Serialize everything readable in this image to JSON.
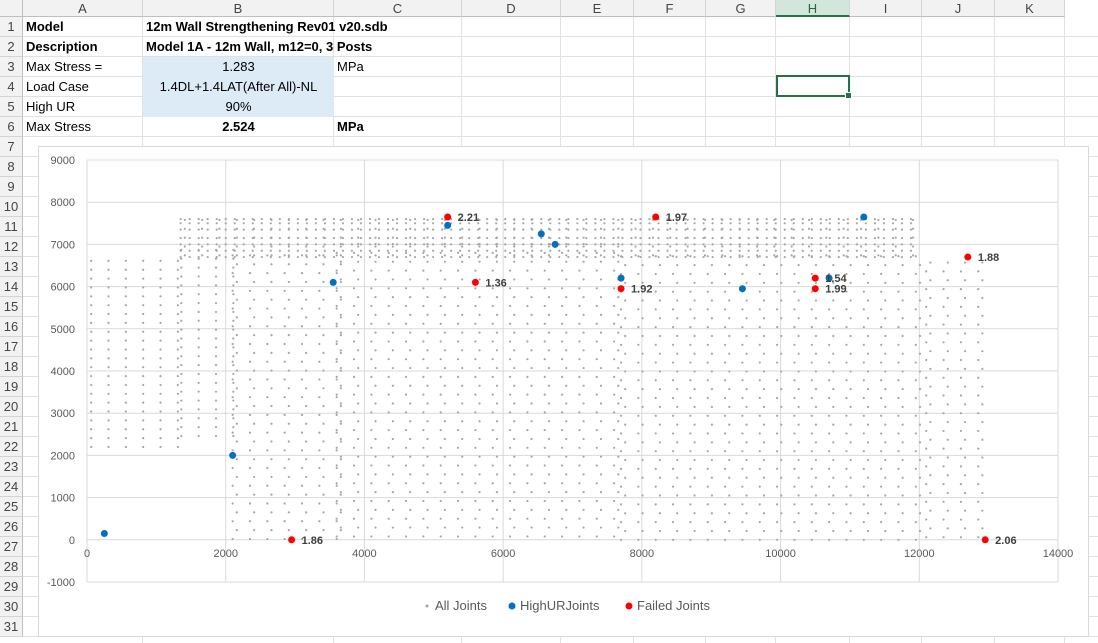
{
  "columns": [
    "A",
    "B",
    "C",
    "D",
    "E",
    "F",
    "G",
    "H",
    "I",
    "J",
    "K"
  ],
  "selected_column": "H",
  "rows": [
    "1",
    "2",
    "3",
    "4",
    "5",
    "6",
    "7",
    "8",
    "9",
    "10",
    "11",
    "12",
    "13",
    "14",
    "15",
    "16",
    "17",
    "18",
    "19",
    "20",
    "21",
    "22",
    "23",
    "24",
    "25",
    "26",
    "27",
    "28",
    "29",
    "30",
    "31"
  ],
  "cells": {
    "A1": "Model",
    "B1": "12m Wall Strengthening Rev01 v20.sdb",
    "A2": "Description",
    "B2": "Model 1A - 12m Wall, m12=0, 3 Posts",
    "A3": "Max Stress =",
    "B3": "1.283",
    "C3": "MPa",
    "A4": "Load Case",
    "B4": "1.4DL+1.4LAT(After All)-NL",
    "A5": "High UR",
    "B5": "90%",
    "A6": "Max Stress",
    "B6": "2.524",
    "C6": "MPa"
  },
  "chart_data": {
    "type": "scatter",
    "title": "",
    "xlabel": "",
    "ylabel": "",
    "xlim": [
      0,
      14000
    ],
    "ylim": [
      -1000,
      9000
    ],
    "x_ticks": [
      "0",
      "2000",
      "4000",
      "6000",
      "8000",
      "10000",
      "12000",
      "14000"
    ],
    "y_ticks": [
      "-1000",
      "0",
      "1000",
      "2000",
      "3000",
      "4000",
      "5000",
      "6000",
      "7000",
      "8000",
      "9000"
    ],
    "grid": true,
    "legend": "bottom",
    "series": [
      {
        "name": "All Joints",
        "color": "#a6a6a6",
        "marker": "small-dot",
        "note_points": "dense grid of joints approx x 0-13000, y 0-7600",
        "regions": [
          {
            "x": [
              0,
              1300
            ],
            "y": [
              2200,
              6700
            ]
          },
          {
            "x": [
              1300,
              2100
            ],
            "y": [
              2400,
              7000
            ]
          },
          {
            "x": [
              2100,
              3600
            ],
            "y": [
              0,
              6800
            ]
          },
          {
            "x": [
              3600,
              7700
            ],
            "y": [
              0,
              7100
            ]
          },
          {
            "x": [
              1350,
              12000
            ],
            "y": [
              6700,
              7600
            ]
          },
          {
            "x": [
              7700,
              12000
            ],
            "y": [
              0,
              6800
            ]
          },
          {
            "x": [
              12100,
              13000
            ],
            "y": [
              0,
              6700
            ]
          }
        ]
      },
      {
        "name": "HighURJoints",
        "color": "#0070c0",
        "points": [
          {
            "x": 250,
            "y": 150
          },
          {
            "x": 2100,
            "y": 2000
          },
          {
            "x": 3550,
            "y": 6100
          },
          {
            "x": 5200,
            "y": 7450
          },
          {
            "x": 6550,
            "y": 7250
          },
          {
            "x": 6750,
            "y": 7000
          },
          {
            "x": 7700,
            "y": 6200
          },
          {
            "x": 9450,
            "y": 5950
          },
          {
            "x": 10700,
            "y": 6200
          },
          {
            "x": 11200,
            "y": 7650
          }
        ]
      },
      {
        "name": "Failed Joints",
        "color": "#ff0000",
        "points": [
          {
            "x": 5200,
            "y": 7650,
            "label": "2.21"
          },
          {
            "x": 8200,
            "y": 7650,
            "label": "1.97"
          },
          {
            "x": 5600,
            "y": 6100,
            "label": "1.36"
          },
          {
            "x": 7700,
            "y": 5950,
            "label": "1.92"
          },
          {
            "x": 10500,
            "y": 6200,
            "label": "1.54"
          },
          {
            "x": 10500,
            "y": 5950,
            "label": "1.99"
          },
          {
            "x": 12700,
            "y": 6700,
            "label": "1.88"
          },
          {
            "x": 2950,
            "y": 0,
            "label": "1.86"
          },
          {
            "x": 12950,
            "y": 0,
            "label": "2.06"
          }
        ]
      }
    ]
  }
}
